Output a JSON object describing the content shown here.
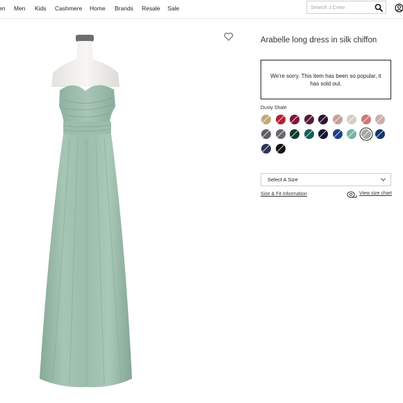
{
  "nav": {
    "items": [
      "en",
      "Men",
      "Kids",
      "Cashmere",
      "Home",
      "Brands",
      "Resale",
      "Sale"
    ],
    "search_placeholder": "Search J.Crew",
    "search_icon": "magnifier",
    "account_icon": "user-circle"
  },
  "product": {
    "title": "Arabelle long dress in silk chiffon",
    "image_alt": "Strapless long sage-green silk chiffon dress on a mannequin",
    "dress_color": "#9bbdab",
    "soldout_message": "We're sorry. This item has been so popular, it has sold out.",
    "selected_color_name": "Dusty Shale",
    "swatches": [
      {
        "color": "#c2a878",
        "unavailable": true,
        "selected": false
      },
      {
        "color": "#b51f33",
        "unavailable": true,
        "selected": false
      },
      {
        "color": "#7e1836",
        "unavailable": true,
        "selected": false
      },
      {
        "color": "#581a3c",
        "unavailable": true,
        "selected": false
      },
      {
        "color": "#2d1530",
        "unavailable": true,
        "selected": false
      },
      {
        "color": "#c79f98",
        "unavailable": true,
        "selected": false
      },
      {
        "color": "#d8cdc4",
        "unavailable": true,
        "selected": false
      },
      {
        "color": "#cc7873",
        "unavailable": true,
        "selected": false
      },
      {
        "color": "#c9aeab",
        "unavailable": true,
        "selected": false
      },
      {
        "color": "#5d5f65",
        "unavailable": true,
        "selected": false
      },
      {
        "color": "#6b6570",
        "unavailable": true,
        "selected": false
      },
      {
        "color": "#123a2e",
        "unavailable": true,
        "selected": false
      },
      {
        "color": "#115e57",
        "unavailable": true,
        "selected": false
      },
      {
        "color": "#15182e",
        "unavailable": true,
        "selected": false
      },
      {
        "color": "#1d3f8a",
        "unavailable": true,
        "selected": false
      },
      {
        "color": "#7ab2a6",
        "unavailable": true,
        "selected": false
      },
      {
        "color": "#a3aaa2",
        "unavailable": true,
        "selected": true
      },
      {
        "color": "#15356b",
        "unavailable": true,
        "selected": false
      },
      {
        "color": "#2e3358",
        "unavailable": true,
        "selected": false
      },
      {
        "color": "#141414",
        "unavailable": true,
        "selected": false
      }
    ],
    "size_select_label": "Select A Size",
    "size_fit_link": "Size & Fit Information",
    "size_chart_link": "View size chart"
  }
}
